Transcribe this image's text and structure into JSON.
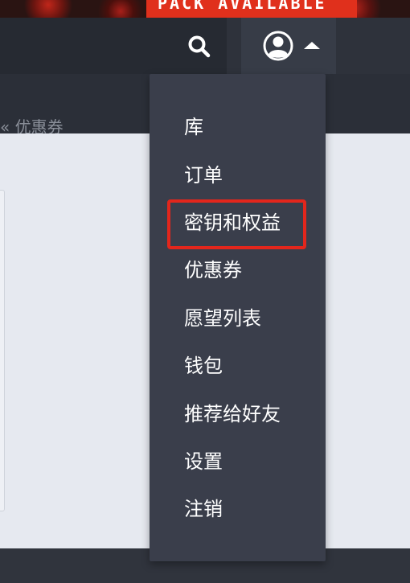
{
  "banner": {
    "text": "PACK AVAILABLE"
  },
  "header": {
    "search_icon": "search-icon",
    "avatar_icon": "user-avatar-icon",
    "caret_icon": "caret-up-icon"
  },
  "breadcrumb": {
    "separator": "«",
    "label": "优惠券"
  },
  "dropdown": {
    "items": [
      {
        "label": "库"
      },
      {
        "label": "订单"
      },
      {
        "label": "密钥和权益",
        "highlighted": true
      },
      {
        "label": "优惠券"
      },
      {
        "label": "愿望列表"
      },
      {
        "label": "钱包"
      },
      {
        "label": "推荐给好友"
      },
      {
        "label": "设置"
      },
      {
        "label": "注销"
      }
    ]
  },
  "colors": {
    "highlight_border": "#e3261c",
    "menu_bg": "#3a3e4b",
    "header_bg": "#2e323b",
    "content_bg": "#e6e9f0"
  }
}
